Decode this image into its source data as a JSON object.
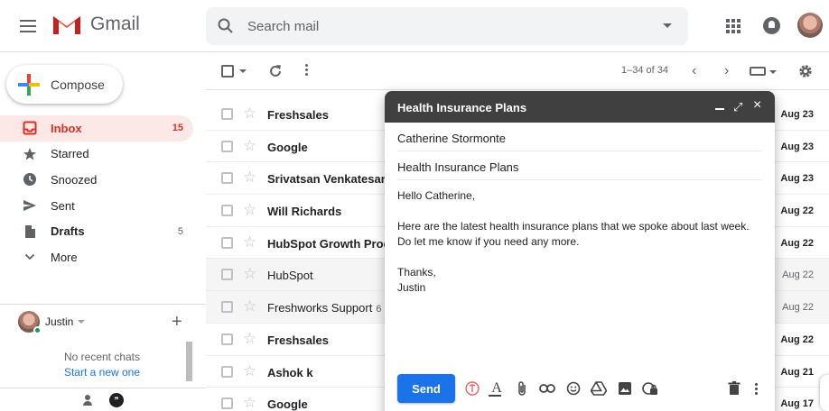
{
  "header": {
    "logo_text": "Gmail",
    "search_placeholder": "Search mail"
  },
  "sidebar": {
    "compose_label": "Compose",
    "items": [
      {
        "label": "Inbox",
        "count": "15",
        "icon": "inbox-icon",
        "active": true
      },
      {
        "label": "Starred",
        "count": "",
        "icon": "star-icon"
      },
      {
        "label": "Snoozed",
        "count": "",
        "icon": "clock-icon"
      },
      {
        "label": "Sent",
        "count": "",
        "icon": "send-icon"
      },
      {
        "label": "Drafts",
        "count": "5",
        "icon": "draft-icon",
        "bold": true
      },
      {
        "label": "More",
        "count": "",
        "icon": "chevron-down-icon"
      }
    ],
    "hangouts": {
      "user_name": "Justin",
      "no_chats": "No recent chats",
      "start_new": "Start a new one"
    }
  },
  "toolbar": {
    "page_count": "1–34 of 34"
  },
  "messages": [
    {
      "sender": "Freshsales",
      "thread": "",
      "date": "Aug 23",
      "unread": true
    },
    {
      "sender": "Google",
      "thread": "",
      "date": "Aug 23",
      "unread": true
    },
    {
      "sender": "Srivatsan Venkatesan",
      "thread": "",
      "date": "Aug 23",
      "unread": true
    },
    {
      "sender": "Will Richards",
      "thread": "",
      "date": "Aug 22",
      "unread": true
    },
    {
      "sender": "HubSpot Growth Prod.",
      "thread": "",
      "date": "Aug 22",
      "unread": true
    },
    {
      "sender": "HubSpot",
      "thread": "",
      "date": "Aug 22",
      "unread": false
    },
    {
      "sender": "Freshworks Support",
      "thread": "6",
      "date": "Aug 22",
      "unread": false
    },
    {
      "sender": "Freshsales",
      "thread": "",
      "date": "Aug 22",
      "unread": true
    },
    {
      "sender": "Ashok k",
      "thread": "",
      "date": "Aug 21",
      "unread": true
    },
    {
      "sender": "Google",
      "thread": "",
      "date": "Aug 17",
      "unread": true
    }
  ],
  "compose_window": {
    "title": "Health Insurance Plans",
    "to": "Catherine Stormonte",
    "subject": "Health Insurance Plans",
    "greeting": "Hello Catherine,",
    "body": "Here are the latest health insurance plans that we spoke about last week. Do let me know if you need any more.",
    "signoff": "Thanks,",
    "signature": "Justin",
    "send_label": "Send"
  },
  "colors": {
    "accent": "#1a73e8",
    "inbox_active_bg": "#fce8e6",
    "inbox_active_text": "#d93025",
    "compose_header": "#404040"
  }
}
